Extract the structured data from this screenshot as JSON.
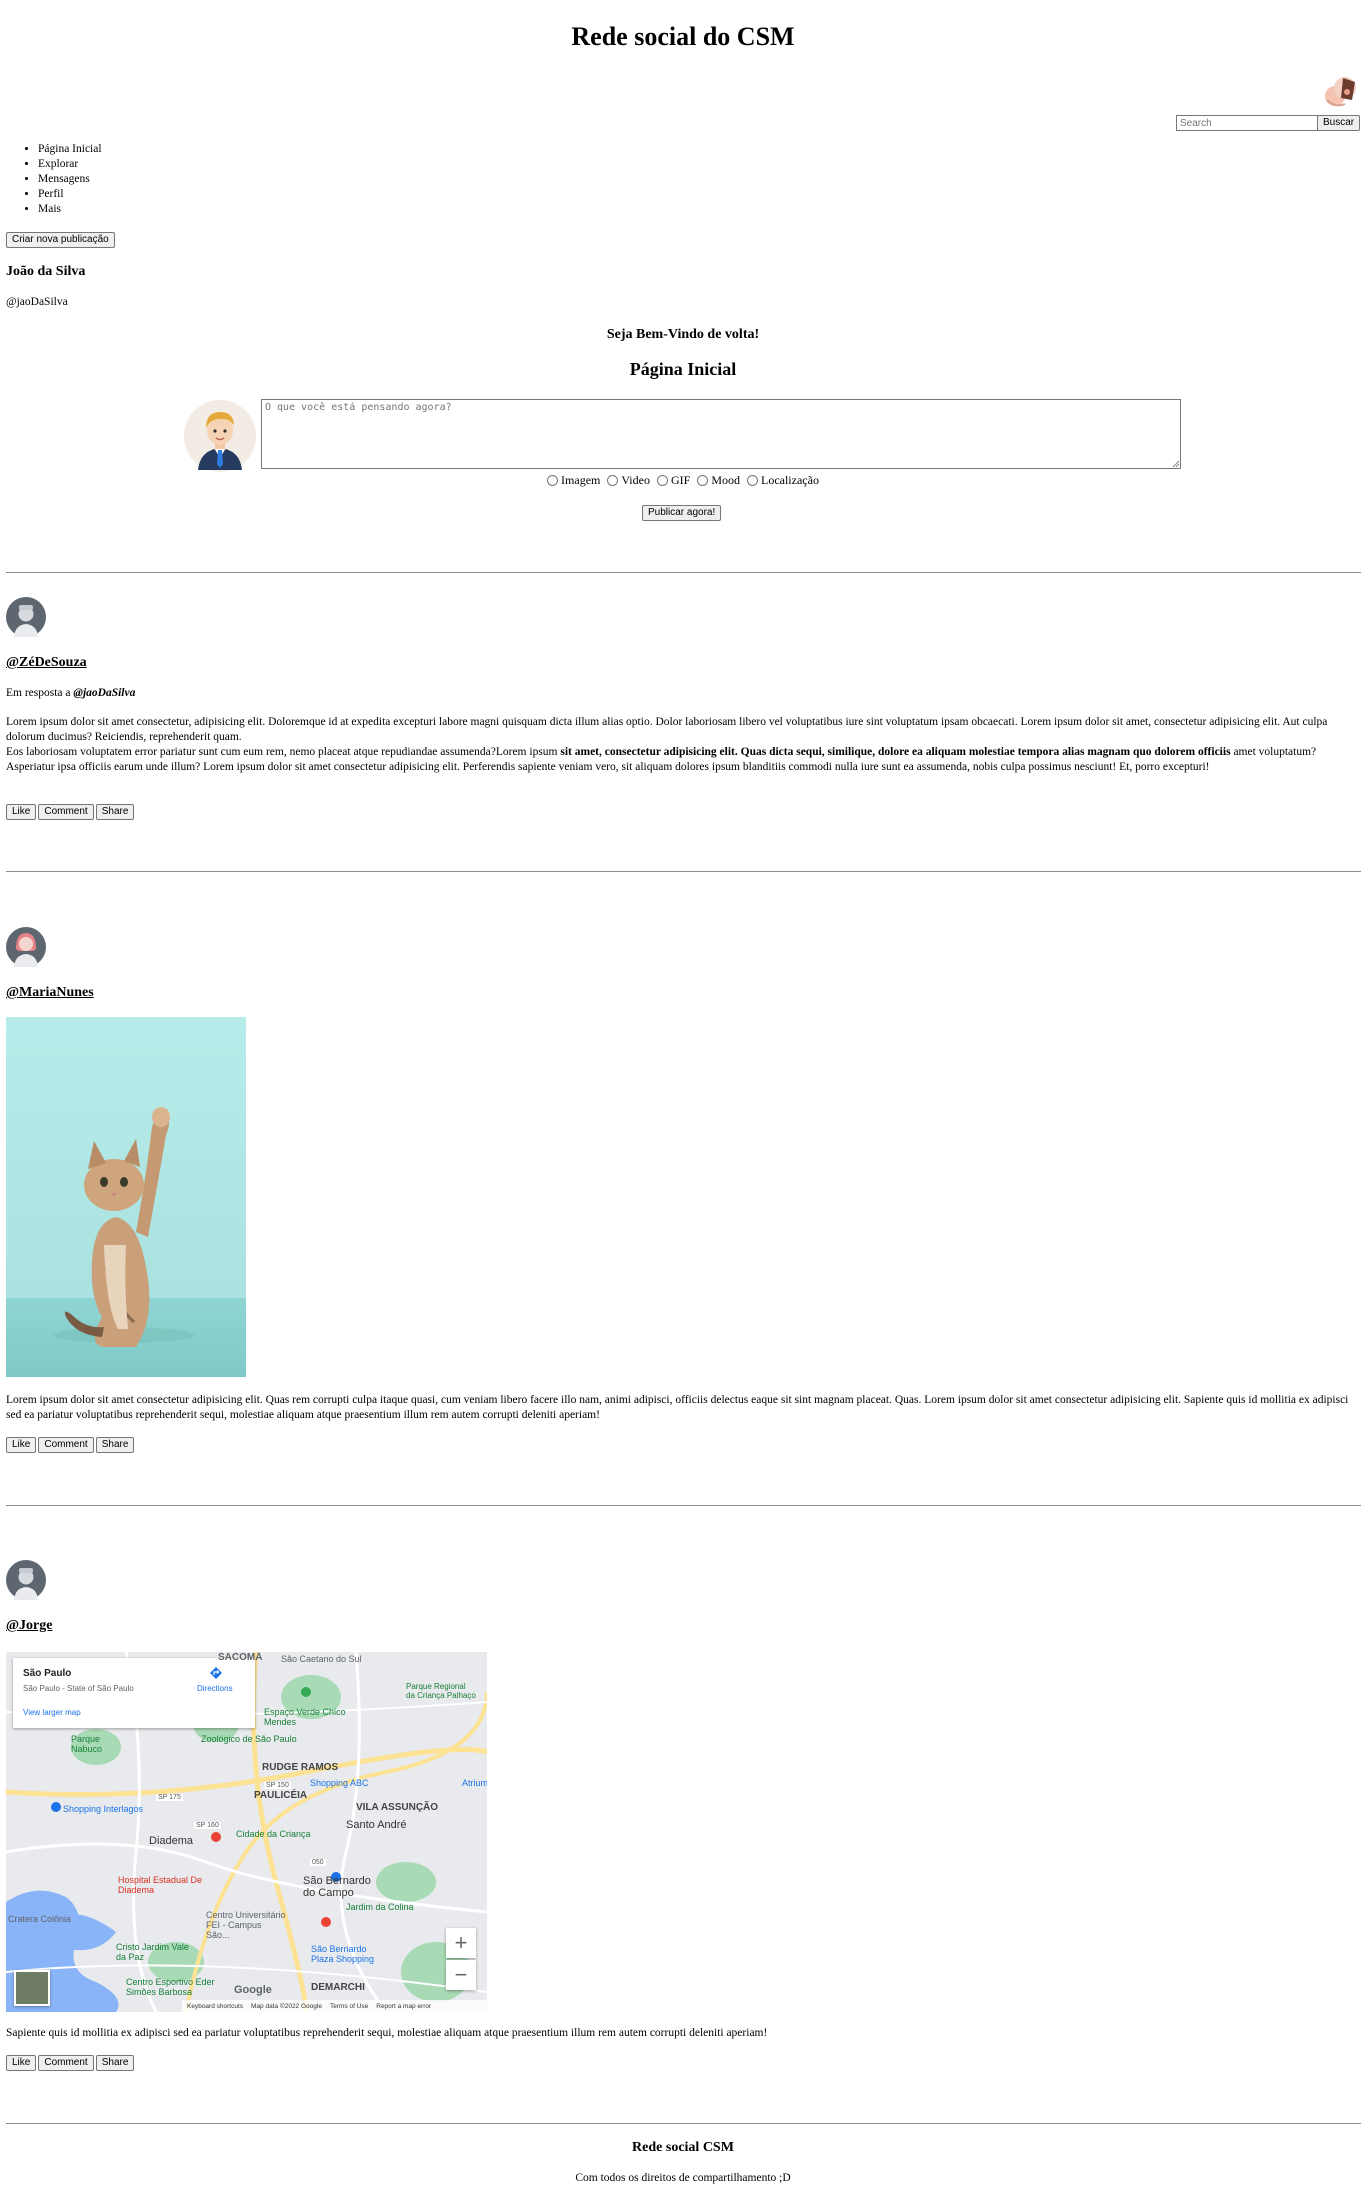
{
  "site": {
    "title": "Rede social do CSM"
  },
  "search": {
    "placeholder": "Search",
    "button": "Buscar"
  },
  "nav": {
    "items": [
      "Página Inicial",
      "Explorar",
      "Mensagens",
      "Perfil",
      "Mais"
    ]
  },
  "sidebar": {
    "create_button": "Criar nova publicação",
    "user_name": "João da Silva",
    "user_handle": "@jaoDaSilva"
  },
  "main": {
    "welcome": "Seja Bem-Vindo de volta!",
    "heading": "Página Inicial",
    "composer_placeholder": "O que você está pensando agora?",
    "options": [
      "Imagem",
      "Video",
      "GIF",
      "Mood",
      "Localização"
    ],
    "publish_button": "Publicar agora!"
  },
  "actions": {
    "like": "Like",
    "comment": "Comment",
    "share": "Share"
  },
  "posts": [
    {
      "author": "@ZéDeSouza",
      "reply_prefix": "Em resposta a",
      "reply_to": "@jaoDaSilva",
      "text_1": "Lorem ipsum dolor sit amet consectetur, adipisicing elit. Doloremque id at expedita excepturi labore magni quisquam dicta illum alias optio. Dolor laboriosam libero vel voluptatibus iure sint voluptatum ipsam obcaecati. Lorem ipsum dolor sit amet, consectetur adipisicing elit. Aut culpa dolorum ducimus? Reiciendis, reprehenderit quam.",
      "text_2a": "Eos laboriosam voluptatem error pariatur sunt cum eum rem, nemo placeat atque repudiandae assumenda?Lorem ipsum ",
      "text_2_bold": "sit amet, consectetur adipisicing elit. Quas dicta sequi, similique, dolore ea aliquam molestiae tempora alias magnam quo dolorem officiis",
      "text_2b": " amet voluptatum? Asperiatur ipsa officiis earum unde illum? Lorem ipsum dolor sit amet consectetur adipisicing elit. Perferendis sapiente veniam vero, sit aliquam dolores ipsum blanditiis commodi nulla iure sunt ea assumenda, nobis culpa possimus nesciunt! Et, porro excepturi!"
    },
    {
      "author": "@MariaNunes",
      "text": "Lorem ipsum dolor sit amet consectetur adipisicing elit. Quas rem corrupti culpa itaque quasi, cum veniam libero facere illo nam, animi adipisci, officiis delectus eaque sit sint magnam placeat. Quas. Lorem ipsum dolor sit amet consectetur adipisicing elit. Sapiente quis id mollitia ex adipisci sed ea pariatur voluptatibus reprehenderit sequi, molestiae aliquam atque praesentium illum rem autem corrupti deleniti aperiam!"
    },
    {
      "author": "@Jorge",
      "text": "Sapiente quis id mollitia ex adipisci sed ea pariatur voluptatibus reprehenderit sequi, molestiae aliquam atque praesentium illum rem autem corrupti deleniti aperiam!"
    }
  ],
  "map": {
    "place_title": "São Paulo",
    "place_subtitle": "São Paulo - State of São Paulo",
    "directions": "Directions",
    "larger_map": "View larger map",
    "zoom_in": "+",
    "zoom_out": "−",
    "google": "Google",
    "footer_links": [
      "Keyboard shortcuts",
      "Map data ©2022 Google",
      "Terms of Use",
      "Report a map error"
    ],
    "labels": [
      "SACOMÃ",
      "São Caetano do Sul",
      "Parque Regional da Criança Palhaço",
      "Espaço Verde Chico Mendes",
      "Parque Nabuco",
      "Zoológico de São Paulo",
      "RUDGE RAMOS",
      "Shopping ABC",
      "PAULICÉIA",
      "VILA ASSUNÇÃO",
      "Shopping Interlagos",
      "Santo André",
      "Diadema",
      "Cidade da Criança",
      "Hospital Estadual De Diadema",
      "São Bernardo do Campo",
      "Jardim da Colina",
      "Centro Universitário FEI - Campus São...",
      "Cratera Colônia",
      "Cristo Jardim Vale da Paz",
      "São Bernardo Plaza Shopping",
      "Centro Esportivo Eder Simões Barbosa",
      "DEMARCHI",
      "SP 150",
      "SP 160",
      "050",
      "SP 175",
      "Atrium"
    ],
    "colors": {
      "water": "#8ab4f8",
      "park": "#a8dab5",
      "road": "#fde293",
      "land": "#e8eaed"
    }
  },
  "footer": {
    "title": "Rede social CSM",
    "copyright": "Com todos os direitos de compartilhamento ;D"
  }
}
